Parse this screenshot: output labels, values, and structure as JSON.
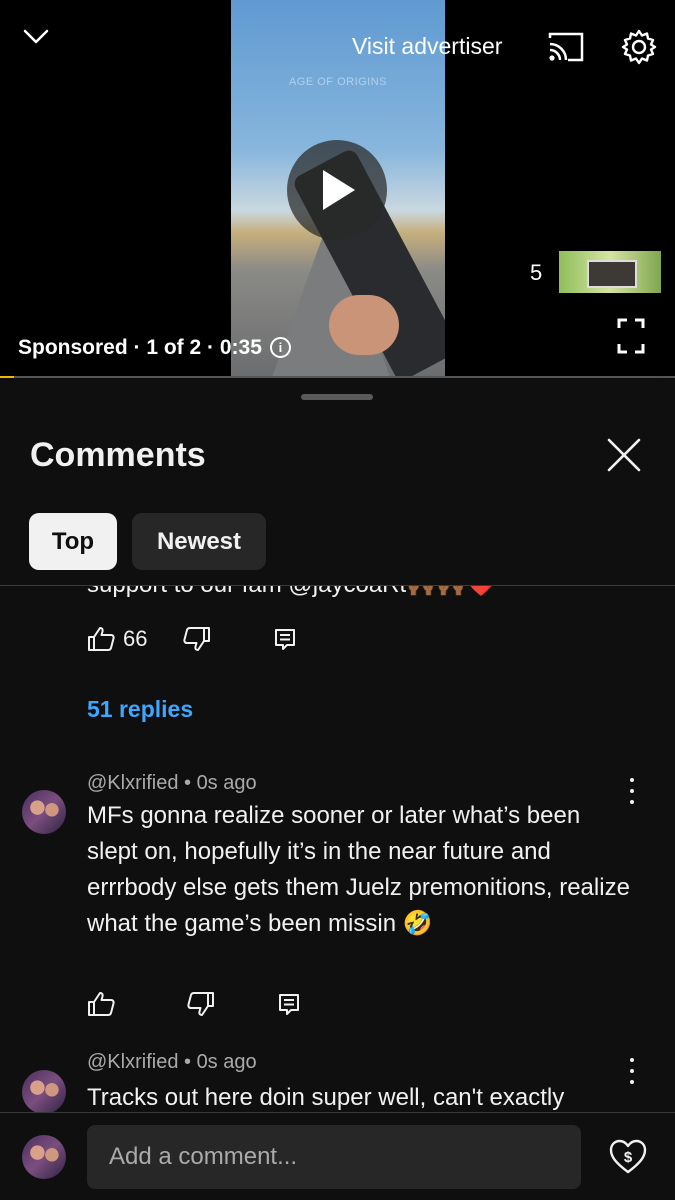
{
  "player": {
    "visit_label": "Visit advertiser",
    "video_watermark": "AGE OF ORIGINS",
    "ad_countdown": "5",
    "sponsored_text": "Sponsored · 1 of 2 · 0:35",
    "progress_fraction": 0.02,
    "progress_color": "#f2b705",
    "icons": [
      "chevron-down-icon",
      "cast-icon",
      "settings-gear-icon",
      "play-icon",
      "info-icon",
      "fullscreen-icon"
    ]
  },
  "sheet": {
    "title": "Comments",
    "tabs": [
      {
        "label": "Top",
        "active": true
      },
      {
        "label": "Newest",
        "active": false
      }
    ]
  },
  "comments": {
    "partial": {
      "text_tail": "support to our fam @jaycoaRt🙌🏾🙌🏾❤️",
      "likes": "66",
      "replies_label": "51 replies"
    },
    "items": [
      {
        "author": "@Klxrified",
        "time": "0s ago",
        "text": "MFs gonna realize sooner or later what’s been slept on, hopefully it’s in the near future and errrbody else gets them Juelz premonitions, realize what the game’s been missin 🤣"
      },
      {
        "author": "@Klxrified",
        "time": "0s ago",
        "text": "Tracks out here doin super well, can't exactly"
      }
    ]
  },
  "composer": {
    "placeholder": "Add a comment..."
  },
  "colors": {
    "background": "#0f0f0f",
    "link_blue": "#3ea6ff",
    "chip_active": "#f1f1f1",
    "chip_inactive": "#272727"
  }
}
